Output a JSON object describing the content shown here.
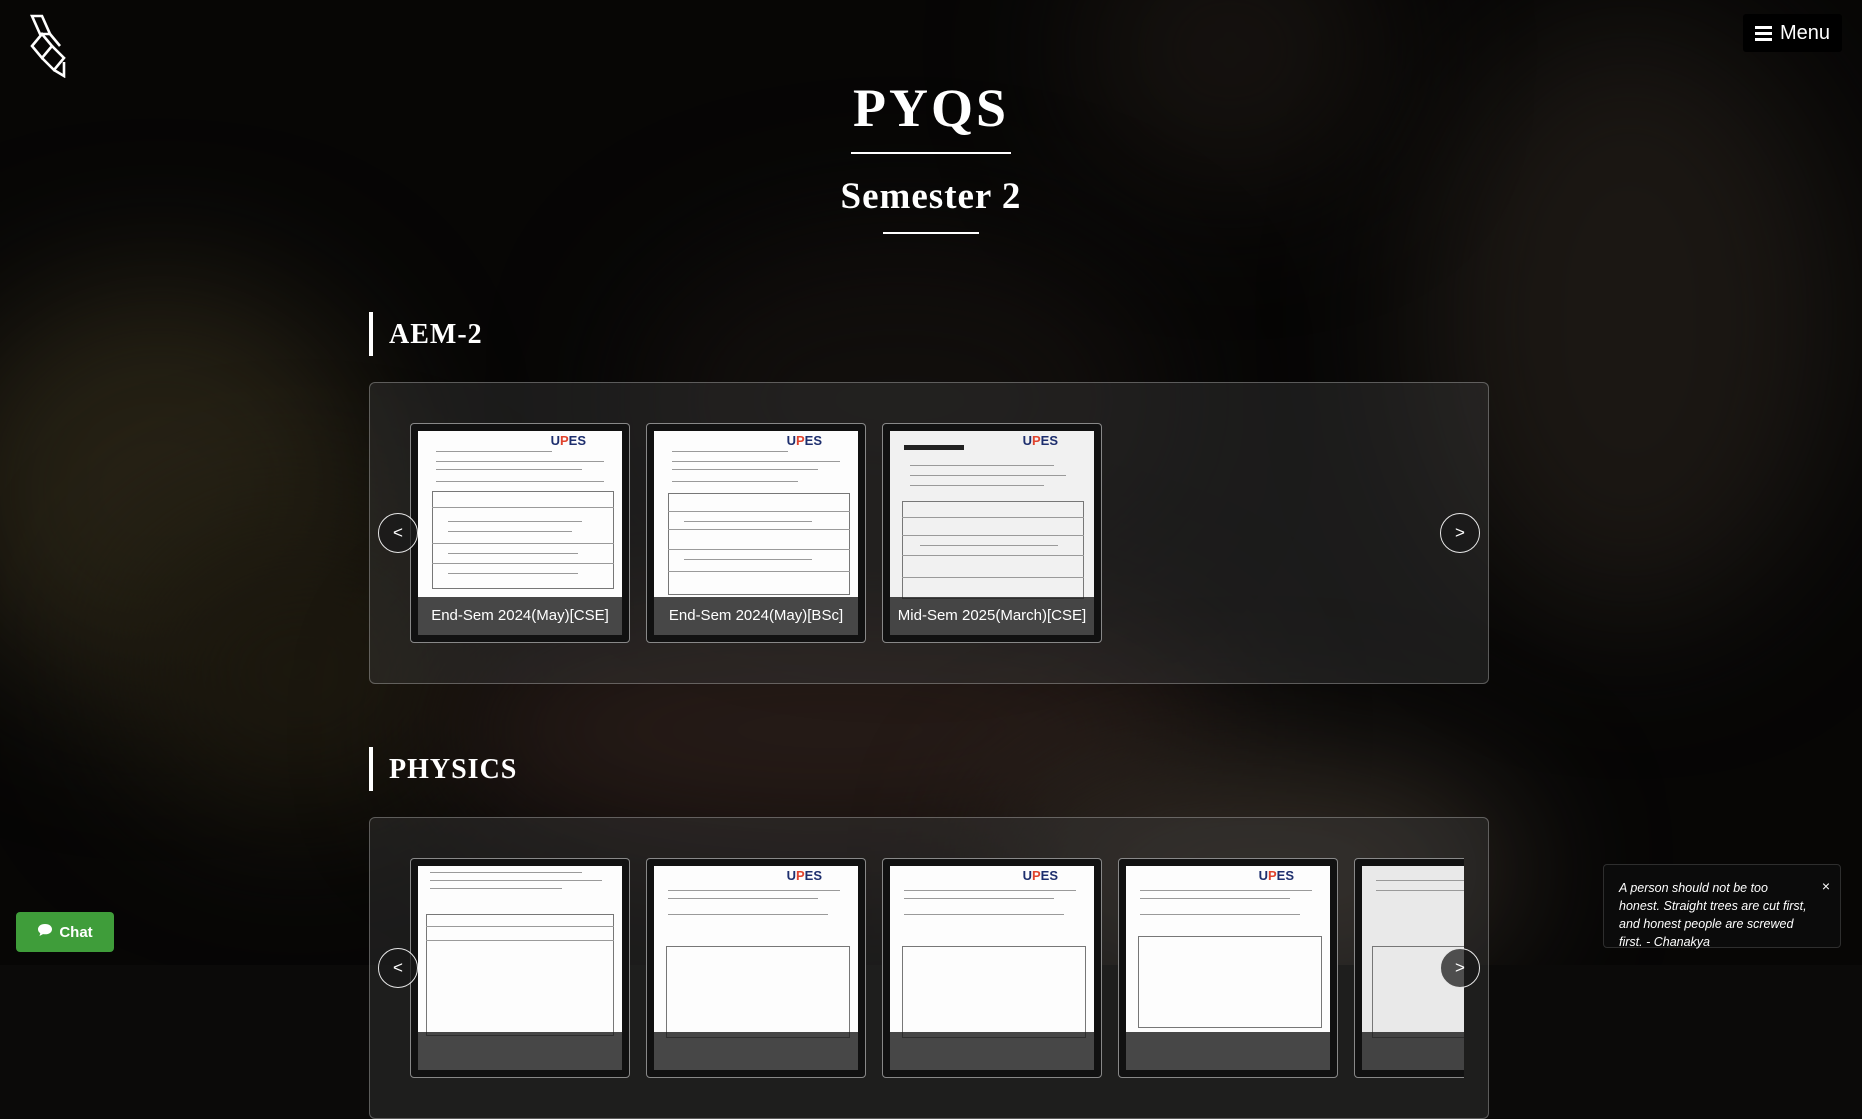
{
  "page": {
    "title": "PYQS",
    "subtitle": "Semester 2"
  },
  "header": {
    "menu_label": "Menu"
  },
  "icons": {
    "logo": "logo-icon",
    "menu": "hamburger-icon",
    "chat": "chat-bubble-icon",
    "close": "close-icon",
    "prev": "chevron-left-icon",
    "next": "chevron-right-icon"
  },
  "sections": [
    {
      "name": "AEM-2",
      "prev_label": "<",
      "next_label": ">",
      "cards": [
        {
          "caption": "End-Sem 2024(May)[CSE]"
        },
        {
          "caption": "End-Sem 2024(May)[BSc]"
        },
        {
          "caption": "Mid-Sem 2025(March)[CSE]"
        }
      ]
    },
    {
      "name": "PHYSICS",
      "prev_label": "<",
      "next_label": ">",
      "cards": [
        {
          "caption": ""
        },
        {
          "caption": ""
        },
        {
          "caption": ""
        },
        {
          "caption": ""
        },
        {
          "caption": ""
        }
      ]
    }
  ],
  "chat": {
    "label": "Chat"
  },
  "quote": {
    "text": "A person should not be too honest. Straight trees are cut first, and honest people are screwed first. - Chanakya",
    "close_label": "×"
  },
  "colors": {
    "background": "#0b0a09",
    "chat_button": "#3f9d3a",
    "brand_blue": "#1e2f6e",
    "brand_red": "#e0432d"
  }
}
